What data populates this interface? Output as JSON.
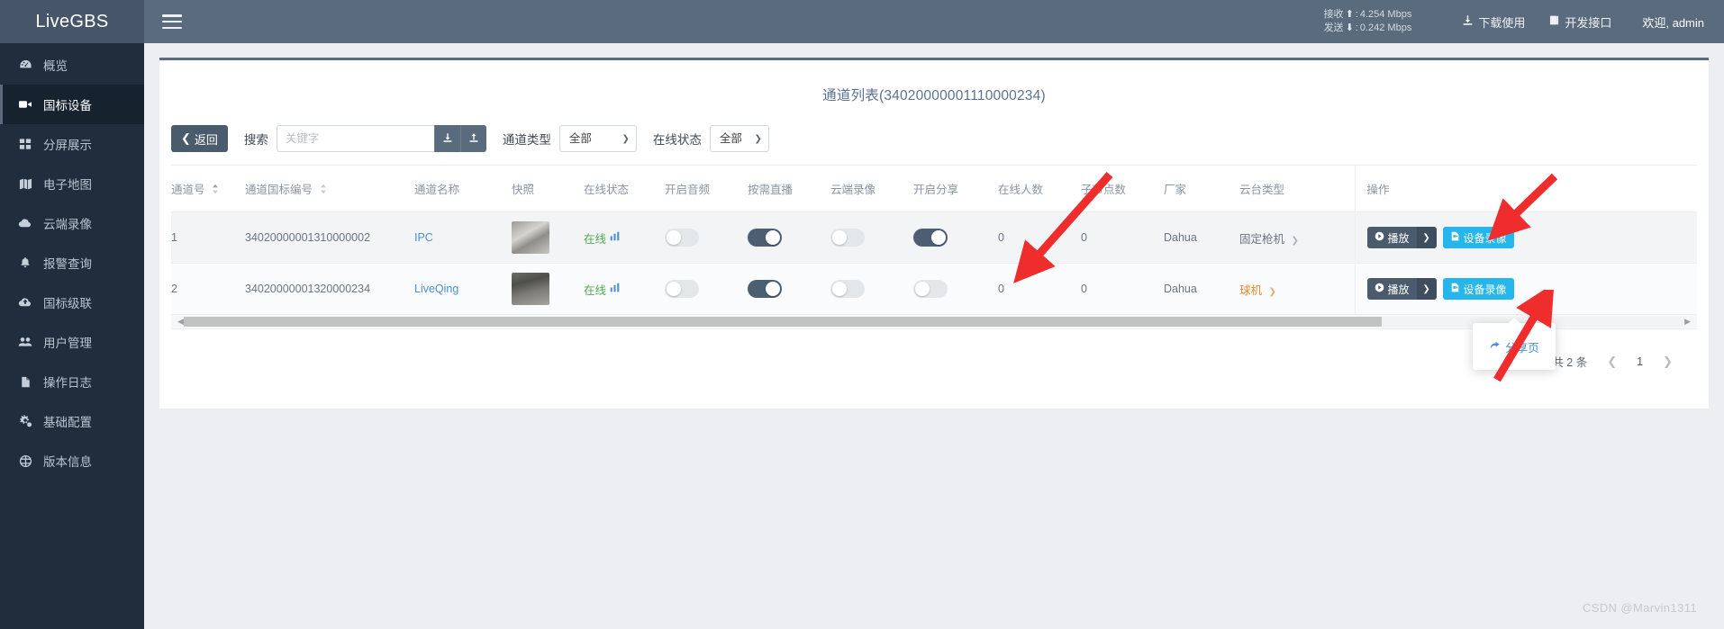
{
  "brand": {
    "name": "LiveGBS"
  },
  "sidebar": {
    "items": [
      {
        "label": "概览",
        "icon": "dashboard-icon",
        "active": false
      },
      {
        "label": "国标设备",
        "icon": "video-camera-icon",
        "active": true
      },
      {
        "label": "分屏展示",
        "icon": "grid-icon",
        "active": false
      },
      {
        "label": "电子地图",
        "icon": "map-icon",
        "active": false
      },
      {
        "label": "云端录像",
        "icon": "cloud-icon",
        "active": false
      },
      {
        "label": "报警查询",
        "icon": "bell-icon",
        "active": false
      },
      {
        "label": "国标级联",
        "icon": "cloud-upload-icon",
        "active": false
      },
      {
        "label": "用户管理",
        "icon": "users-icon",
        "active": false
      },
      {
        "label": "操作日志",
        "icon": "file-icon",
        "active": false
      },
      {
        "label": "基础配置",
        "icon": "gears-icon",
        "active": false
      },
      {
        "label": "版本信息",
        "icon": "info-circle-icon",
        "active": false
      }
    ]
  },
  "topbar": {
    "menu_icon": "hamburger-icon",
    "net": {
      "recv_label": "接收",
      "recv_value": "4.254 Mbps",
      "send_label": "发送",
      "send_value": "0.242 Mbps"
    },
    "download_label": "下载使用",
    "api_label": "开发接口",
    "user_label": "欢迎, admin"
  },
  "page": {
    "title": "通道列表(34020000001110000234)"
  },
  "toolbar": {
    "back_label": "返回",
    "search_label": "搜索",
    "search_value": "",
    "search_placeholder": "关键字",
    "import_icon": "download-icon",
    "export_icon": "upload-icon",
    "channel_type_label": "通道类型",
    "channel_type_value": "全部",
    "online_state_label": "在线状态",
    "online_state_value": "全部"
  },
  "table": {
    "columns": [
      {
        "label": "通道号",
        "sortable": true
      },
      {
        "label": "通道国标编号",
        "sortable": true
      },
      {
        "label": "通道名称",
        "sortable": false
      },
      {
        "label": "快照",
        "sortable": false
      },
      {
        "label": "在线状态",
        "sortable": false
      },
      {
        "label": "开启音频",
        "sortable": false
      },
      {
        "label": "按需直播",
        "sortable": false
      },
      {
        "label": "云端录像",
        "sortable": false
      },
      {
        "label": "开启分享",
        "sortable": false
      },
      {
        "label": "在线人数",
        "sortable": false
      },
      {
        "label": "子节点数",
        "sortable": false
      },
      {
        "label": "厂家",
        "sortable": false
      },
      {
        "label": "云台类型",
        "sortable": false
      },
      {
        "label": "操作",
        "sortable": false
      }
    ],
    "rows": [
      {
        "no": "1",
        "gb_id": "34020000001310000002",
        "name": "IPC",
        "snapshot": "snapshot-thumbnail",
        "status": "在线",
        "status_icon": "bar-chart-icon",
        "audio_on": false,
        "on_demand": true,
        "cloud_record": false,
        "share_on": true,
        "online_count": "0",
        "child_count": "0",
        "vendor": "Dahua",
        "ptz_type": "固定枪机",
        "ptz_color": "#6b7480",
        "play_label": "播放",
        "record_label": "设备录像"
      },
      {
        "no": "2",
        "gb_id": "34020000001320000234",
        "name": "LiveQing",
        "snapshot": "snapshot-thumbnail",
        "status": "在线",
        "status_icon": "bar-chart-icon",
        "audio_on": false,
        "on_demand": true,
        "cloud_record": false,
        "share_on": false,
        "online_count": "0",
        "child_count": "0",
        "vendor": "Dahua",
        "ptz_type": "球机",
        "ptz_color": "#e88b2e",
        "play_label": "播放",
        "record_label": "设备录像"
      }
    ]
  },
  "dropdown": {
    "open": true,
    "items": [
      {
        "label": "分享页",
        "icon": "share-icon"
      }
    ]
  },
  "pagination": {
    "total_label": "共 2 条",
    "prev_icon": "chevron-left-icon",
    "current_page": "1",
    "next_icon": "chevron-right-icon"
  },
  "watermark": "CSDN @Marvin1311",
  "colors": {
    "sidebar_bg": "#1f2d3d",
    "topbar_bg": "#5a6b7d",
    "accent_blue": "#4a8fd4",
    "cyan_button": "#27b6ec",
    "orange": "#e88b2e",
    "green_online": "#4eaa52",
    "toggle_on": "#4c5f72",
    "annotation_red": "#ef2d2d"
  }
}
